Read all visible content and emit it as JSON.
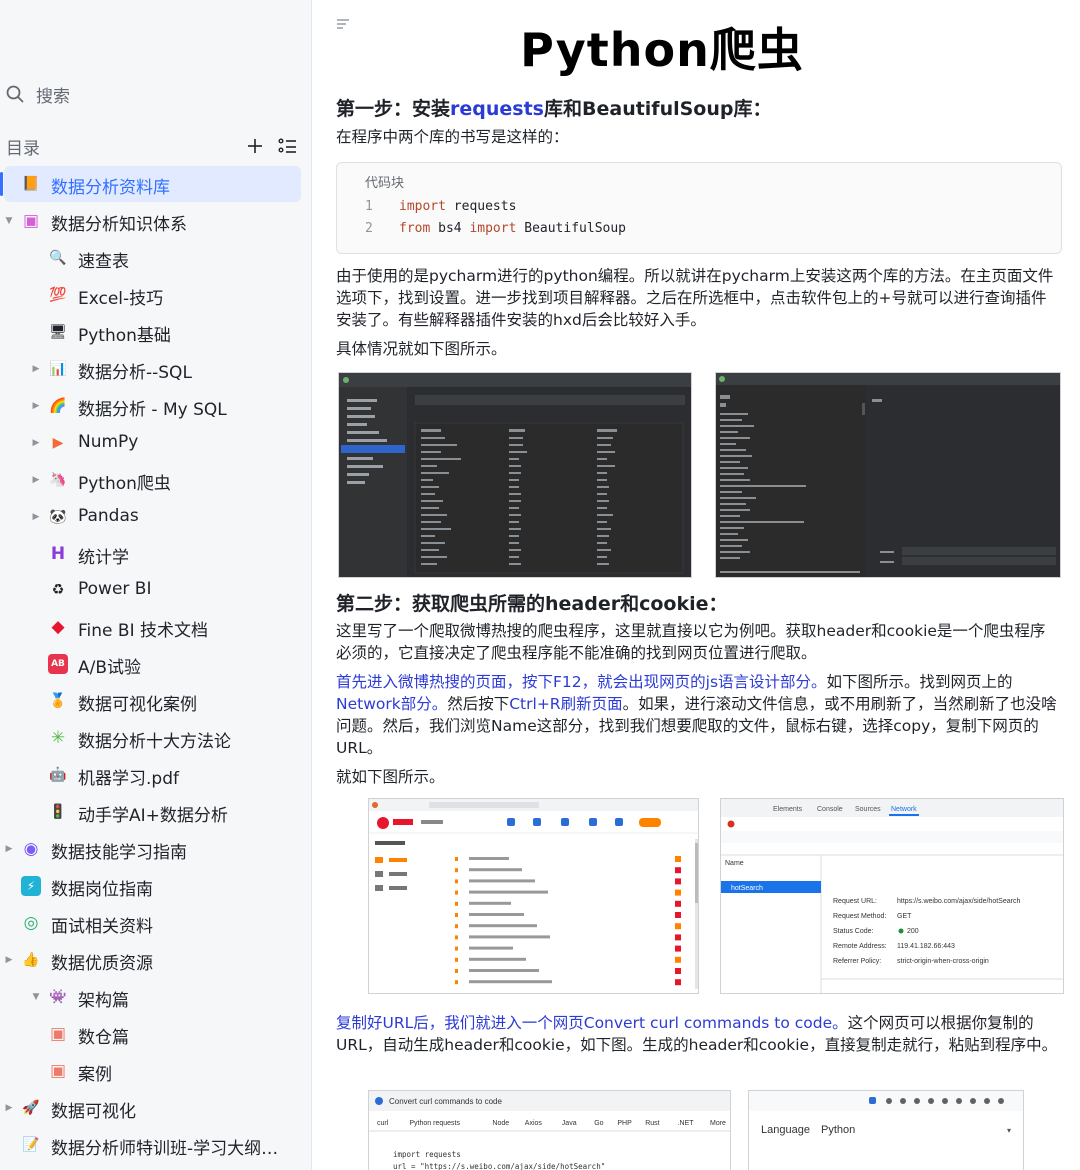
{
  "sidebar": {
    "search_label": "搜索",
    "toc_label": "目录",
    "tree": [
      {
        "label": "数据分析资料库",
        "icon": "📙",
        "icon_name": "folder-orange-icon",
        "depth": 0,
        "caret": false,
        "selected": true
      },
      {
        "label": "数据分析知识体系",
        "icon": "▣",
        "icon_name": "knowledge-pink-icon",
        "depth": 0,
        "caret": "open",
        "selected": false
      },
      {
        "label": "速查表",
        "icon": "🔍",
        "icon_name": "magnifier-icon",
        "depth": 1,
        "caret": false,
        "selected": false
      },
      {
        "label": "Excel-技巧",
        "icon": "💯",
        "icon_name": "hundred-points-icon",
        "depth": 1,
        "caret": false,
        "selected": false
      },
      {
        "label": "Python基础",
        "icon": "🖥",
        "icon_name": "monitor-icon",
        "depth": 1,
        "caret": false,
        "selected": false
      },
      {
        "label": "数据分析--SQL",
        "icon": "📊",
        "icon_name": "bar-chart-icon",
        "depth": 1,
        "caret": "closed",
        "selected": false
      },
      {
        "label": "数据分析 - My SQL",
        "icon": "🌈",
        "icon_name": "rainbow-icon",
        "depth": 1,
        "caret": "closed",
        "selected": false
      },
      {
        "label": "NumPy",
        "icon": "▶",
        "icon_name": "arrow-icon",
        "depth": 1,
        "caret": "closed",
        "selected": false
      },
      {
        "label": "Python爬虫",
        "icon": "🦄",
        "icon_name": "unicorn-icon",
        "depth": 1,
        "caret": "closed",
        "selected": false
      },
      {
        "label": "Pandas",
        "icon": "🐼",
        "icon_name": "panda-icon",
        "depth": 1,
        "caret": "closed",
        "selected": false
      },
      {
        "label": "统计学",
        "icon": "H",
        "icon_name": "letter-h-icon",
        "depth": 1,
        "caret": false,
        "selected": false
      },
      {
        "label": "Power BI",
        "icon": "♻",
        "icon_name": "recycle-icon",
        "depth": 1,
        "caret": false,
        "selected": false
      },
      {
        "label": "Fine BI 技术文档",
        "icon": "◆",
        "icon_name": "red-diamond-icon",
        "depth": 1,
        "caret": false,
        "selected": false
      },
      {
        "label": "A/B试验",
        "icon": "AB",
        "icon_name": "ab-test-icon",
        "depth": 1,
        "caret": false,
        "selected": false
      },
      {
        "label": "数据可视化案例",
        "icon": "🏅",
        "icon_name": "medal-icon",
        "depth": 1,
        "caret": false,
        "selected": false
      },
      {
        "label": "数据分析十大方法论",
        "icon": "✳",
        "icon_name": "sparkle-icon",
        "depth": 1,
        "caret": false,
        "selected": false
      },
      {
        "label": "机器学习.pdf",
        "icon": "🤖",
        "icon_name": "robot-icon",
        "depth": 1,
        "caret": false,
        "selected": false
      },
      {
        "label": "动手学AI+数据分析",
        "icon": "🚦",
        "icon_name": "traffic-light-icon",
        "depth": 1,
        "caret": false,
        "selected": false
      },
      {
        "label": "数据技能学习指南",
        "icon": "◉",
        "icon_name": "skills-purple-icon",
        "depth": 0,
        "caret": "closed",
        "selected": false
      },
      {
        "label": "数据岗位指南",
        "icon": "⚡",
        "icon_name": "lightning-icon",
        "depth": 0,
        "caret": false,
        "selected": false
      },
      {
        "label": "面试相关资料",
        "icon": "◎",
        "icon_name": "interview-green-icon",
        "depth": 0,
        "caret": false,
        "selected": false
      },
      {
        "label": "数据优质资源",
        "icon": "👍",
        "icon_name": "thumbs-up-icon",
        "depth": 0,
        "caret": "closed",
        "selected": false
      },
      {
        "label": "架构篇",
        "icon": "👾",
        "icon_name": "architecture-icon",
        "depth": 1,
        "caret": "open",
        "selected": false
      },
      {
        "label": "数仓篇",
        "icon": "▣",
        "icon_name": "warehouse-icon",
        "depth": 1,
        "caret": false,
        "selected": false
      },
      {
        "label": "案例",
        "icon": "▣",
        "icon_name": "case-icon",
        "depth": 1,
        "caret": false,
        "selected": false
      },
      {
        "label": "数据可视化",
        "icon": "🚀",
        "icon_name": "rocket-icon",
        "depth": 0,
        "caret": "closed",
        "selected": false
      },
      {
        "label": "数据分析师特训班-学习大纲（…",
        "icon": "📝",
        "icon_name": "memo-icon",
        "depth": 0,
        "caret": false,
        "selected": false
      }
    ]
  },
  "doc": {
    "title": "Python爬虫",
    "step1": {
      "prefix": "第一步：安装",
      "link": "requests",
      "suffix": "库和BeautifulSoup库："
    },
    "step1_intro": "在程序中两个库的书写是这样的：",
    "code": {
      "label": "代码块",
      "lines": [
        {
          "num": "1",
          "kw": "import",
          "rest": " requests"
        },
        {
          "num": "2",
          "kw": "from",
          "mid": " bs4 ",
          "kw2": "import",
          "rest": " BeautifulSoup"
        }
      ]
    },
    "para1": "由于使用的是pycharm进行的python编程。所以就讲在pycharm上安装这两个库的方法。在主页面文件选项下，找到设置。进一步找到项目解释器。之后在所选框中，点击软件包上的+号就可以进行查询插件安装了。有些解释器插件安装的hxd后会比较好入手。",
    "para2": "具体情况就如下图所示。",
    "step2": "第二步：获取爬虫所需的header和cookie：",
    "para3": "这里写了一个爬取微博热搜的爬虫程序，这里就直接以它为例吧。获取header和cookie是一个爬虫程序必须的，它直接决定了爬虫程序能不能准确的找到网页位置进行爬取。",
    "para4_link": "首先进入微博热搜的页面，按下F12，就会出现网页的js语言设计部分。",
    "para4_text1": "如下图所示。找到网页上的",
    "para4_link2": "Network部分。",
    "para4_text2": "然后按下",
    "para4_link3": "Ctrl+R刷新页面",
    "para4_text3": "。如果，进行滚动文件信息，或不用刷新了，当然刷新了也没啥问题。然后，我们浏览Name这部分，找到我们想要爬取的文件，鼠标右键，选择copy，复制下网页的URL。",
    "para5": "就如下图所示。",
    "para6_link": "复制好URL后，我们就进入一个网页Convert curl commands to code。",
    "para6_text": "这个网页可以根据你复制的URL，自动生成header和cookie，如下图。生成的header和cookie，直接复制走就行，粘贴到程序中。",
    "shot_devtools": {
      "tabs": [
        "Elements",
        "Console",
        "Sources",
        "Network"
      ],
      "name_col": "Name",
      "selected_file": "hotSearch",
      "request_url_label": "Request URL:",
      "request_url": "https://s.weibo.com/ajax/side/hotSearch",
      "method_label": "Request Method:",
      "method": "GET",
      "status_label": "Status Code:",
      "status": "200",
      "remote_label": "Remote Address:",
      "remote": "119.41.182.66:443",
      "referrer_label": "Referrer Policy:",
      "referrer": "strict-origin-when-cross-origin"
    },
    "shot_convert": {
      "title": "Convert curl commands to code",
      "tabs": [
        "curl",
        "Python requests",
        "Node",
        "Axios",
        "Java",
        "Go",
        "PHP",
        "Rust",
        ".NET",
        "More"
      ],
      "code1": "import requests",
      "code2": "url = \"https://s.weibo.com/ajax/side/hotSearch\"",
      "lang_label": "Language",
      "lang_value": "Python"
    }
  }
}
